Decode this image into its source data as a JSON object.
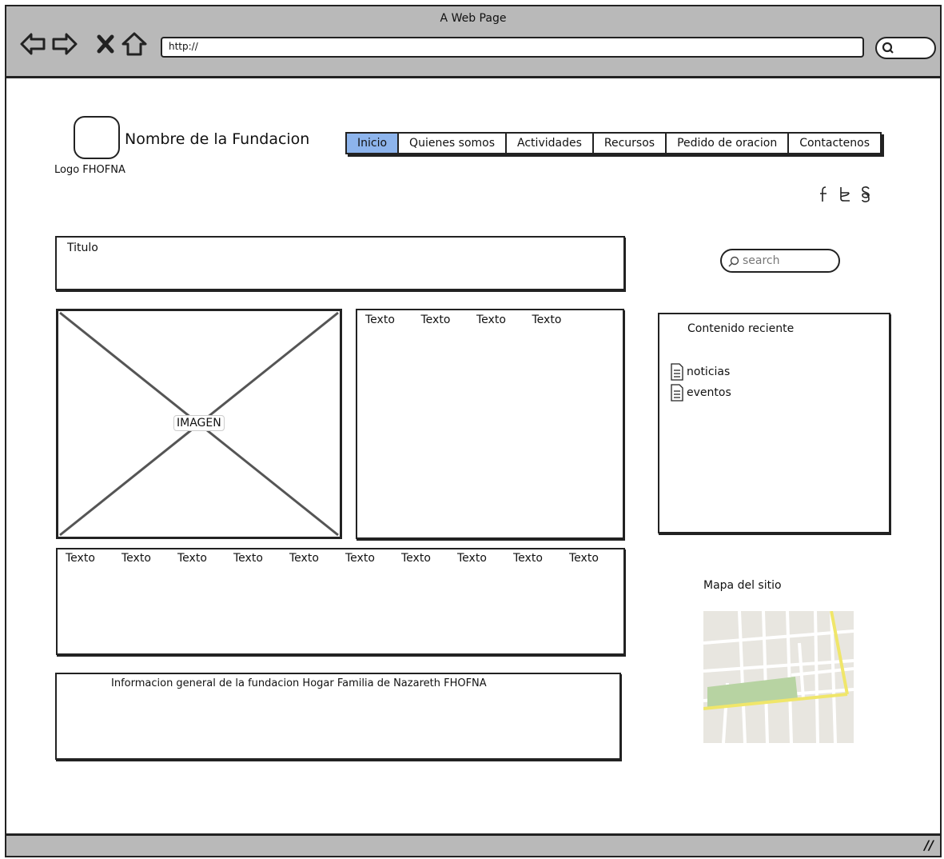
{
  "browser": {
    "window_title": "A Web Page",
    "url": "http://"
  },
  "header": {
    "logo_label": "Logo FHOFNA",
    "org_name": "Nombre de la Fundacion"
  },
  "menu": {
    "items": [
      {
        "label": "Inicio",
        "active": true
      },
      {
        "label": "Quienes somos",
        "active": false
      },
      {
        "label": "Actividades",
        "active": false
      },
      {
        "label": "Recursos",
        "active": false
      },
      {
        "label": "Pedido de oracion",
        "active": false
      },
      {
        "label": "Contactenos",
        "active": false
      }
    ],
    "active_color": "#8db4ec"
  },
  "social": {
    "icons": [
      "facebook-icon",
      "twitter-icon",
      "google-plus-icon"
    ],
    "glyphs": [
      "f",
      "t",
      "g"
    ]
  },
  "main": {
    "title_label": "Titulo",
    "image_label": "IMAGEN",
    "text_row_1": [
      "Texto",
      "Texto",
      "Texto",
      "Texto"
    ],
    "text_row_2": [
      "Texto",
      "Texto",
      "Texto",
      "Texto",
      "Texto",
      "Texto",
      "Texto",
      "Texto",
      "Texto",
      "Texto"
    ],
    "info_text": "Informacion general de la fundacion Hogar Familia de Nazareth FHOFNA"
  },
  "sidebar": {
    "search_placeholder": "search",
    "recent_title": "Contenido reciente",
    "recent_items": [
      "noticias",
      "eventos"
    ],
    "map_title": "Mapa del sitio"
  }
}
